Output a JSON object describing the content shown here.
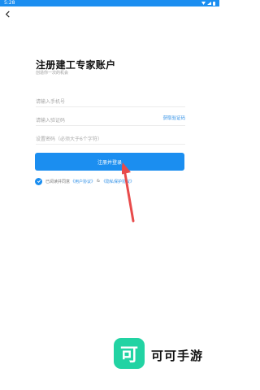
{
  "status_bar": {
    "time": "5:28"
  },
  "header": {
    "title": "注册建工专家账户",
    "subtitle": "创造你一次的机会"
  },
  "form": {
    "phone_placeholder": "请输入手机号",
    "code_placeholder": "请输入验证码",
    "get_code_label": "获取验证码",
    "password_placeholder": "设置密码（必须大于6个字符）",
    "submit_label": "注册并登录"
  },
  "agreement": {
    "prefix": "已阅读并同意",
    "user_agreement": "《用户协议》",
    "separator": "&",
    "privacy_policy": "《隐私保护协议》"
  },
  "watermark": {
    "logo_char": "可",
    "brand_name": "可可手游"
  },
  "colors": {
    "accent": "#1b8ef0",
    "arrow": "#e84b4b",
    "logo_bg": "#22d3a3"
  }
}
